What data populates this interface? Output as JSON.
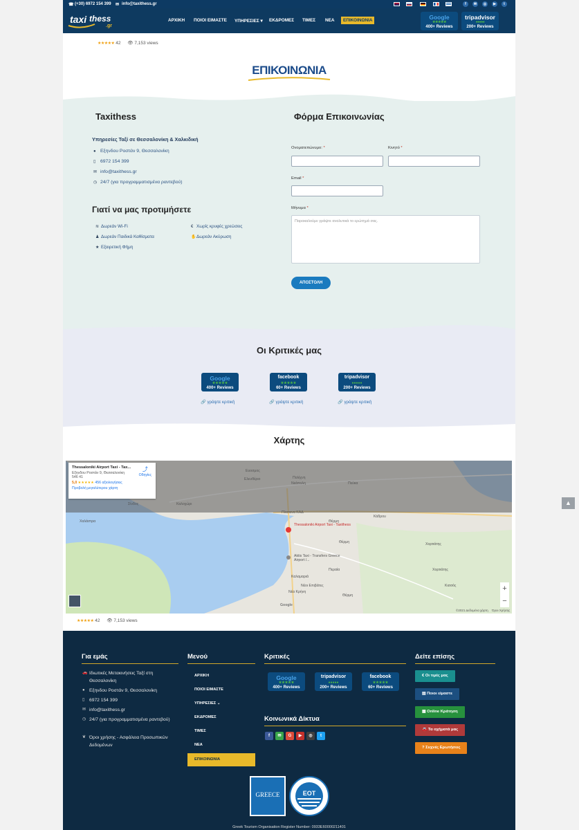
{
  "topbar": {
    "phone": "(+30) 6972 154 399",
    "email": "info@taxithess.gr",
    "languages": [
      "en",
      "ru",
      "de",
      "fr",
      "el"
    ],
    "socials": [
      "facebook",
      "mail",
      "instagram",
      "youtube",
      "twitter"
    ]
  },
  "nav": {
    "logo_text": "taxi thess .gr",
    "items": [
      "ΑΡΧΙΚΗ",
      "ΠΟΙΟΙ ΕΙΜΑΣΤΕ",
      "ΥΠΗΡΕΣΙΕΣ",
      "ΕΚΔΡΟΜΕΣ",
      "ΤΙΜΕΣ",
      "ΝΕΑ",
      "ΕΠΙΚΟΙΝΩΝΙΑ"
    ],
    "active_item": "ΕΠΙΚΟΙΝΩΝΙΑ",
    "badges": [
      {
        "name": "Google",
        "label": "400+ Reviews"
      },
      {
        "name": "tripadvisor",
        "label": "200+ Reviews"
      }
    ]
  },
  "meta_top": {
    "rating_count": "42",
    "views": "7,153 views"
  },
  "hero": {
    "title": "ΕΠΙΚΟΙΝΩΝΙΑ"
  },
  "contact": {
    "company": "Taxithess",
    "subtitle": "Υπηρεσίες Ταξί σε Θεσσαλονίκη & Χαλκιδική",
    "address": "Εξηνδου Ροστάν 9, Θεσσαλονίκη",
    "phone": "6972 154 399",
    "email": "info@taxithess.gr",
    "hours": "24/7 (για προγραμματισμένα ραντεβού)"
  },
  "why": {
    "title": "Γιατί να μας προτιμήσετε",
    "left": [
      "Δωρεάν Wi-Fi",
      "Δωρεάν Παιδικά Καθίσματα",
      "Εξαιρετική Φήμη"
    ],
    "right": [
      "Χωρίς κρυφές χρεώσεις",
      "Δωρεάν Ακύρωση"
    ]
  },
  "form": {
    "title": "Φόρμα Επικοινωνίας",
    "name_label": "Ονοματεπώνυμο:",
    "phone_label": "Κινητό",
    "email_label": "Email",
    "message_label": "Μήνυμα",
    "message_placeholder": "Παρακαλούμε γράψτε αναλυτικά το ερώτημά σας.",
    "submit": "ΑΠΟΣΤΟΛΗ",
    "required_mark": "*"
  },
  "reviews": {
    "title": "Οι Κριτικές μας",
    "items": [
      {
        "name": "Google",
        "label": "400+ Reviews",
        "link": "γράψτε κριτική"
      },
      {
        "name": "facebook",
        "label": "60+ Reviews",
        "link": "γράψτε κριτική"
      },
      {
        "name": "tripadvisor",
        "label": "200+ Reviews",
        "link": "γράψτε κριτική"
      }
    ]
  },
  "map": {
    "title": "Χάρτης",
    "card_title": "Thessaloniki Airport Taxi - Tax...",
    "card_address": "Εξηνδου Ροστάν 9, Θεσσαλονίκη 546 41",
    "card_rating": "5,0",
    "card_reviews": "456 αξιολογήσεις",
    "card_link": "Προβολή μεγαλύτερου χάρτη",
    "directions": "Οδηγίες",
    "pin_label": "Thessaloniki Airport Taxi - Taxithess",
    "pin2_label": "Aktis Taxi - Transfers Greece Airport /...",
    "places": [
      "Ευοσμος",
      "Πολίχνη",
      "Ελευθέριο",
      "Νεάπολη",
      "Πεύκα",
      "Καλοχώρι",
      "Σίνδος",
      "Χαλάστρα",
      "Περαία",
      "Καλαμαριά",
      "Νέοι Επιβάτες",
      "Νέα Κρήνη",
      "Χορτιάτης",
      "Θέρμη",
      "Κισσός",
      "Πλατανα ΚΑΔ",
      "Κάδρου",
      "Χορτιάτης",
      "Θέρμη",
      "Θέρμη"
    ],
    "copyright": "©2021 Δεδομένα χάρτη",
    "terms": "Όροι Χρήσης",
    "google": "Google"
  },
  "meta_bottom": {
    "rating_count": "42",
    "views": "7,153 views"
  },
  "footer": {
    "about_title": "Για εμάς",
    "about_items": [
      "Ιδιωτικές Μετακινήσεις Ταξί στη Θεσσαλονίκη",
      "Εξηνδου Ροστάν 9, Θεσσαλονίκη",
      "6972 154 399",
      "info@taxithess.gr",
      "24/7 (για προγραμματισμένα ραντεβού)",
      "Όροι χρήσης - Ασφάλεια Προσωπικών Δεδομένων"
    ],
    "menu_title": "Μενού",
    "menu_items": [
      "ΑΡΧΙΚΗ",
      "ΠΟΙΟΙ ΕΙΜΑΣΤΕ",
      "ΥΠΗΡΕΣΙΕΣ",
      "ΕΚΔΡΟΜΕΣ",
      "ΤΙΜΕΣ",
      "ΝΕΑ",
      "ΕΠΙΚΟΙΝΩΝΙΑ"
    ],
    "reviews_title": "Κριτικές",
    "review_badges": [
      {
        "name": "Google",
        "label": "400+ Reviews"
      },
      {
        "name": "tripadvisor",
        "label": "200+ Reviews"
      },
      {
        "name": "facebook",
        "label": "60+ Reviews"
      }
    ],
    "social_title": "Κοινωνικά Δίκτυα",
    "see_title": "Δείτε επίσης",
    "see_buttons": [
      {
        "label": "€ Οι τιμές μας",
        "color": "#1a8f8f"
      },
      {
        "label": "Ποιοι είμαστε",
        "color": "#1c4f80"
      },
      {
        "label": "Online Κράτηση",
        "color": "#27913d"
      },
      {
        "label": "Τα οχήματά μας",
        "color": "#b03a3a"
      },
      {
        "label": "? Συχνές Ερωτήσεις",
        "color": "#e8821a"
      }
    ],
    "greece_logo": "GREECE",
    "eot_logo": "ΕΟΤ",
    "register": "Greek Tourism Organisation Register Number: 0933E60000211401"
  }
}
